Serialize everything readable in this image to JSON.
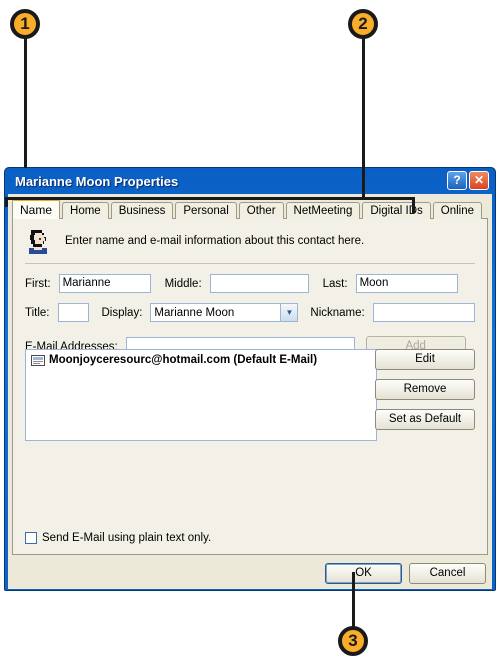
{
  "callouts": [
    {
      "number": "1",
      "target": "dialog-title-bar"
    },
    {
      "number": "2",
      "target": "tab-strip"
    },
    {
      "number": "3",
      "target": "ok-button"
    }
  ],
  "dialog": {
    "title": "Marianne Moon Properties",
    "titlebar_buttons": [
      {
        "name": "help-button",
        "glyph": "?"
      },
      {
        "name": "close-button",
        "glyph": "✕"
      }
    ],
    "tabs": [
      {
        "label": "Name",
        "active": true
      },
      {
        "label": "Home",
        "active": false
      },
      {
        "label": "Business",
        "active": false
      },
      {
        "label": "Personal",
        "active": false
      },
      {
        "label": "Other",
        "active": false
      },
      {
        "label": "NetMeeting",
        "active": false
      },
      {
        "label": "Digital IDs",
        "active": false
      },
      {
        "label": "Online",
        "active": false
      }
    ],
    "header": {
      "icon": "contact-person-icon",
      "caption": "Enter name and e-mail information about this contact here."
    },
    "fields": {
      "first_label": "First:",
      "first_value": "Marianne",
      "middle_label": "Middle:",
      "middle_value": "",
      "last_label": "Last:",
      "last_value": "Moon",
      "title_label": "Title:",
      "title_value": "",
      "display_label": "Display:",
      "display_value": "Marianne Moon",
      "nickname_label": "Nickname:",
      "nickname_value": ""
    },
    "email": {
      "addresses_label": "E-Mail Addresses:",
      "input_value": "",
      "add_label": "Add",
      "add_disabled": true,
      "list_items": [
        {
          "icon": "mail-envelope-icon",
          "text": "Moonjoyceresourc@hotmail.com  (Default E-Mail)"
        }
      ],
      "edit_label": "Edit",
      "remove_label": "Remove",
      "set_default_label": "Set as Default"
    },
    "plain_text_checkbox": {
      "label": "Send E-Mail using plain text only.",
      "checked": false
    },
    "footer": {
      "ok_label": "OK",
      "cancel_label": "Cancel"
    }
  },
  "colors": {
    "callout_fill": "#f9ad2a",
    "callout_ring": "#1a1a1a",
    "titlebar_blue": "#1272d8",
    "active_tab_accent": "#f5a623",
    "dialog_face": "#ece9d8"
  }
}
